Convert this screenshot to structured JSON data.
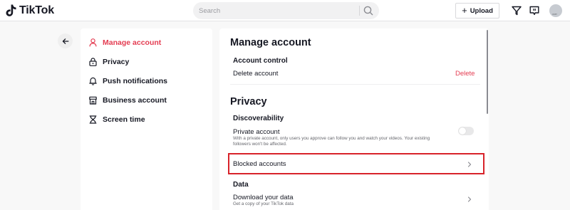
{
  "header": {
    "logo_text": "TikTok",
    "search_placeholder": "Search",
    "upload_label": "Upload",
    "avatar_tag": "user"
  },
  "sidebar": {
    "items": [
      {
        "label": "Manage account",
        "icon": "person-icon",
        "active": true
      },
      {
        "label": "Privacy",
        "icon": "lock-icon",
        "active": false
      },
      {
        "label": "Push notifications",
        "icon": "bell-icon",
        "active": false
      },
      {
        "label": "Business account",
        "icon": "store-icon",
        "active": false
      },
      {
        "label": "Screen time",
        "icon": "hourglass-icon",
        "active": false
      }
    ]
  },
  "manage_account": {
    "title": "Manage account",
    "account_control": "Account control",
    "delete_account_label": "Delete account",
    "delete_action": "Delete"
  },
  "privacy": {
    "title": "Privacy",
    "discoverability": "Discoverability",
    "private_account_label": "Private account",
    "private_account_desc": "With a private account, only users you approve can follow you and watch your videos. Your existing followers won't be affected.",
    "private_account_enabled": false,
    "blocked_accounts_label": "Blocked accounts",
    "data_title": "Data",
    "download_data_label": "Download your data",
    "download_data_desc": "Get a copy of your TikTok data"
  },
  "colors": {
    "accent": "#e43d52",
    "highlight_box": "#d8232a",
    "text": "#161823"
  }
}
